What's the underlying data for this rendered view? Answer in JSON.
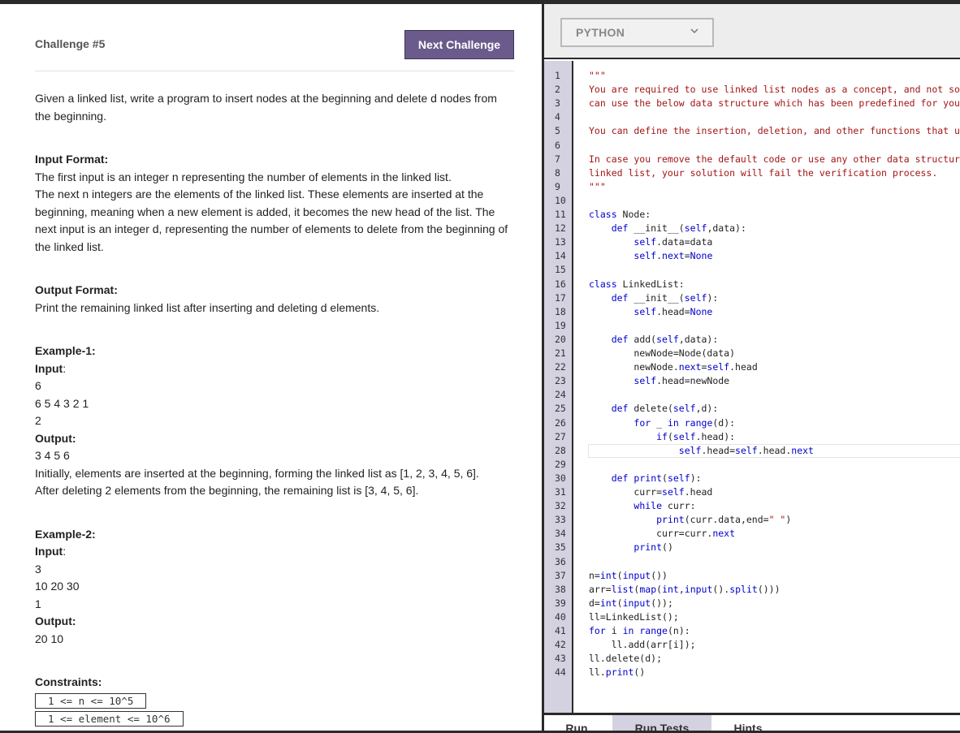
{
  "challenge": {
    "title": "Challenge #5",
    "next_button": "Next Challenge",
    "description": "Given a linked list, write a program to insert nodes at the beginning and delete d nodes from the beginning.",
    "input_format_heading": "Input Format:",
    "input_format_lines": [
      "The first input is an integer n representing the number of elements in the linked list.",
      "The next n integers are the elements of the linked list. These elements are inserted at the beginning, meaning when a new element is added, it becomes the new head of the list. The next input is an integer d, representing the number of elements to delete from the beginning of the linked list."
    ],
    "output_format_heading": "Output Format:",
    "output_format_text": "Print the remaining linked list after inserting and deleting d elements.",
    "example1": {
      "heading": "Example-1:",
      "input_label": "Input",
      "input_lines": [
        "6",
        "6 5 4 3 2 1",
        "2"
      ],
      "output_label": "Output:",
      "output_lines": [
        "3 4 5 6"
      ],
      "explanation": [
        "Initially, elements are inserted at the beginning, forming the linked list as [1, 2, 3, 4, 5, 6].",
        "After deleting 2 elements from the beginning, the remaining list is [3, 4, 5, 6]."
      ]
    },
    "example2": {
      "heading": "Example-2:",
      "input_label": "Input",
      "input_lines": [
        "3",
        "10 20 30",
        "1"
      ],
      "output_label": "Output:",
      "output_lines": [
        "20 10"
      ]
    },
    "constraints_heading": "Constraints:",
    "constraints": [
      "1 <= n <= 10^5",
      "1 <= element <= 10^6"
    ]
  },
  "editor": {
    "language": "PYTHON",
    "code_lines": [
      "\"\"\"",
      "You are required to use linked list nodes as a concept, and not solve it using other data structures. You",
      "can use the below data structure which has been predefined for you",
      "",
      "You can define the insertion, deletion, and other functions that use the below data structure.",
      "",
      "In case you remove the default code or use any other data structure or library to implement the",
      "linked list, your solution will fail the verification process.",
      "\"\"\"",
      "",
      "class Node:",
      "    def __init__(self,data):",
      "        self.data=data",
      "        self.next=None",
      "",
      "class LinkedList:",
      "    def __init__(self):",
      "        self.head=None",
      "",
      "    def add(self,data):",
      "        newNode=Node(data)",
      "        newNode.next=self.head",
      "        self.head=newNode",
      "",
      "    def delete(self,d):",
      "        for _ in range(d):",
      "            if(self.head):",
      "                self.head=self.head.next",
      "",
      "    def print(self):",
      "        curr=self.head",
      "        while curr:",
      "            print(curr.data,end=\" \")",
      "            curr=curr.next",
      "        print()",
      "",
      "n=int(input())",
      "arr=list(map(int,input().split()))",
      "d=int(input());",
      "ll=LinkedList();",
      "for i in range(n):",
      "    ll.add(arr[i]);",
      "ll.delete(d);",
      "ll.print()"
    ],
    "active_line": 28
  },
  "tabs": {
    "run": "Run",
    "run_tests": "Run Tests",
    "hints": "Hints"
  },
  "colors": {
    "accent_button": "#6b5b8c",
    "gutter": "#d4d1e0",
    "keyword": "#0000cc",
    "comment_string": "#a31515"
  }
}
